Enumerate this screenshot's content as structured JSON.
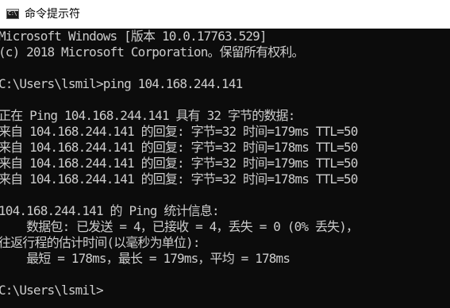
{
  "window": {
    "title": "命令提示符",
    "icon": "command-prompt-icon"
  },
  "console": {
    "lines": [
      "Microsoft Windows [版本 10.0.17763.529]",
      "(c) 2018 Microsoft Corporation。保留所有权利。",
      "",
      "C:\\Users\\lsmil>ping 104.168.244.141",
      "",
      "正在 Ping 104.168.244.141 具有 32 字节的数据:",
      "来自 104.168.244.141 的回复: 字节=32 时间=179ms TTL=50",
      "来自 104.168.244.141 的回复: 字节=32 时间=178ms TTL=50",
      "来自 104.168.244.141 的回复: 字节=32 时间=179ms TTL=50",
      "来自 104.168.244.141 的回复: 字节=32 时间=178ms TTL=50",
      "",
      "104.168.244.141 的 Ping 统计信息:",
      "    数据包: 已发送 = 4，已接收 = 4，丢失 = 0 (0% 丢失)，",
      "往返行程的估计时间(以毫秒为单位):",
      "    最短 = 178ms，最长 = 179ms，平均 = 178ms",
      "",
      "C:\\Users\\lsmil>"
    ],
    "colors": {
      "background": "#0c0c0c",
      "text": "#cccccc"
    }
  }
}
